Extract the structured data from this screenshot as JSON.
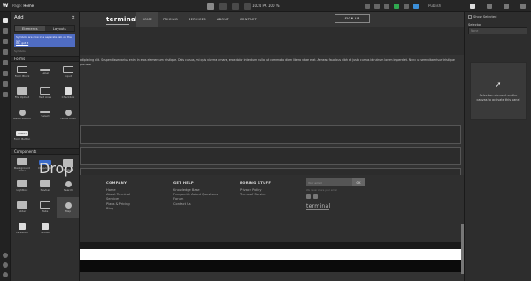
{
  "topbar": {
    "logo": "W",
    "page_prefix": "Page:",
    "page_name": "Home",
    "canvas_size": "1024 PX 100 %",
    "publish_label": "Publish"
  },
  "add_panel": {
    "title": "Add",
    "close": "×",
    "tabs": [
      "Elements",
      "Layouts"
    ],
    "note_text": "Symbols are now in a separate tab on the left.",
    "note_link": "OK, got it",
    "ghost_label": "Symbols",
    "forms_section": "Forms",
    "forms": [
      {
        "label": "Form Block",
        "glyph": "box"
      },
      {
        "label": "Label",
        "glyph": "text"
      },
      {
        "label": "Input",
        "glyph": "box"
      },
      {
        "label": "File Upload",
        "glyph": "fill"
      },
      {
        "label": "Text Area",
        "glyph": "box"
      },
      {
        "label": "Checkbox",
        "glyph": "sq"
      },
      {
        "label": "Radio Button",
        "glyph": "round"
      },
      {
        "label": "Select",
        "glyph": "line"
      },
      {
        "label": "reCAPTCHA",
        "glyph": "round"
      },
      {
        "label": "Form Button",
        "glyph": "btn",
        "btn_text": "SUBMIT"
      }
    ],
    "components_section": "Components",
    "components": [
      {
        "label": "Background Video",
        "glyph": "fill"
      },
      {
        "label": "Dropdown",
        "glyph": "dropdown",
        "btn_text": "Drop"
      },
      {
        "label": "Embed",
        "glyph": "code"
      },
      {
        "label": "Lightbox",
        "glyph": "fill"
      },
      {
        "label": "Navbar",
        "glyph": "fill"
      },
      {
        "label": "Search",
        "glyph": "round"
      },
      {
        "label": "Slider",
        "glyph": "fill"
      },
      {
        "label": "Tabs",
        "glyph": "box"
      },
      {
        "label": "Map",
        "glyph": "round"
      },
      {
        "label": "Facebook",
        "glyph": "sq"
      },
      {
        "label": "Twitter",
        "glyph": "sq"
      }
    ]
  },
  "site": {
    "logo": "terminal",
    "nav": [
      "HOME",
      "PRICING",
      "SERVICES",
      "ABOUT",
      "CONTACT"
    ],
    "signup": "SIGN UP",
    "paragraph": "adipiscing elit. Suspendisse varius enim in eros elementum tristique. Duis cursus, mi quis viverra ornare, eros dolor interdum nulla, ut commodo diam libero vitae erat. Aenean faucibus nibh et justo cursus id rutrum lorem imperdiet. Nunc ut sem vitae risus tristique posuere.",
    "footer": {
      "columns": [
        {
          "title": "COMPANY",
          "links": [
            "Home",
            "About Terminal",
            "Services",
            "Plans & Pricing",
            "Blog"
          ]
        },
        {
          "title": "GET HELP",
          "links": [
            "Knowledge Base",
            "Frequently Asked Questions",
            "Forum",
            "Contact Us"
          ]
        },
        {
          "title": "BORING STUFF",
          "links": [
            "Privacy Policy",
            "Terms of Service"
          ]
        }
      ],
      "newsletter_placeholder": "Your email",
      "newsletter_button": "OK",
      "small_text": "We never share your email",
      "logo": "terminal"
    }
  },
  "right_panel": {
    "show_selected": "Show Selected",
    "selector_label": "Selector",
    "selector_placeholder": "None",
    "empty_message": "Select an element on the canvas to activate this panel",
    "cursor": "➚"
  }
}
